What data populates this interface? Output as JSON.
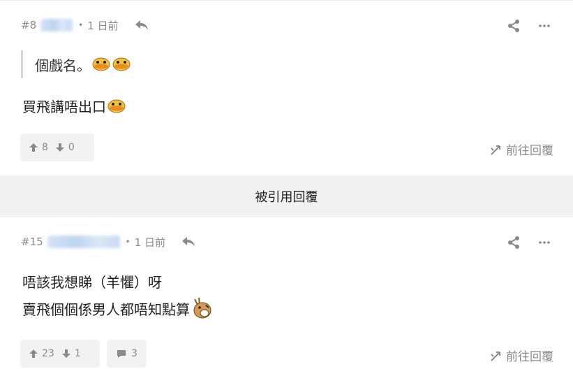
{
  "post1": {
    "number": "#8",
    "separator": "•",
    "time": "1 日前",
    "quote": "個戲名。",
    "line1": "買飛講唔出口",
    "emojis": [
      "duck-face",
      "duck-face",
      "duck-face"
    ],
    "upvotes": "8",
    "downvotes": "0",
    "goto_reply": "前往回覆"
  },
  "quoted_replies_label": "被引用回覆",
  "post2": {
    "number": "#15",
    "separator": "•",
    "time": "1 日前",
    "line1": "唔該我想睇（羊懼）呀",
    "line2": "賣飛個個係男人都唔知點算",
    "emojis": [
      "deer-laugh"
    ],
    "upvotes": "23",
    "downvotes": "1",
    "comments": "3",
    "goto_reply": "前往回覆"
  },
  "colors": {
    "meta_text": "#8a8a8a",
    "body_text": "#222222",
    "vote_bg": "#f2f2f2",
    "quoted_bar_bg": "#f1f1f1",
    "quote_border": "#d8d8d8"
  },
  "icons": {
    "reply": "reply-arrow-icon",
    "share": "share-icon",
    "more": "more-dots-icon",
    "upvote": "arrow-up-icon",
    "downvote": "arrow-down-icon",
    "comment": "comment-bubble-icon",
    "goto": "goto-reply-icon"
  }
}
